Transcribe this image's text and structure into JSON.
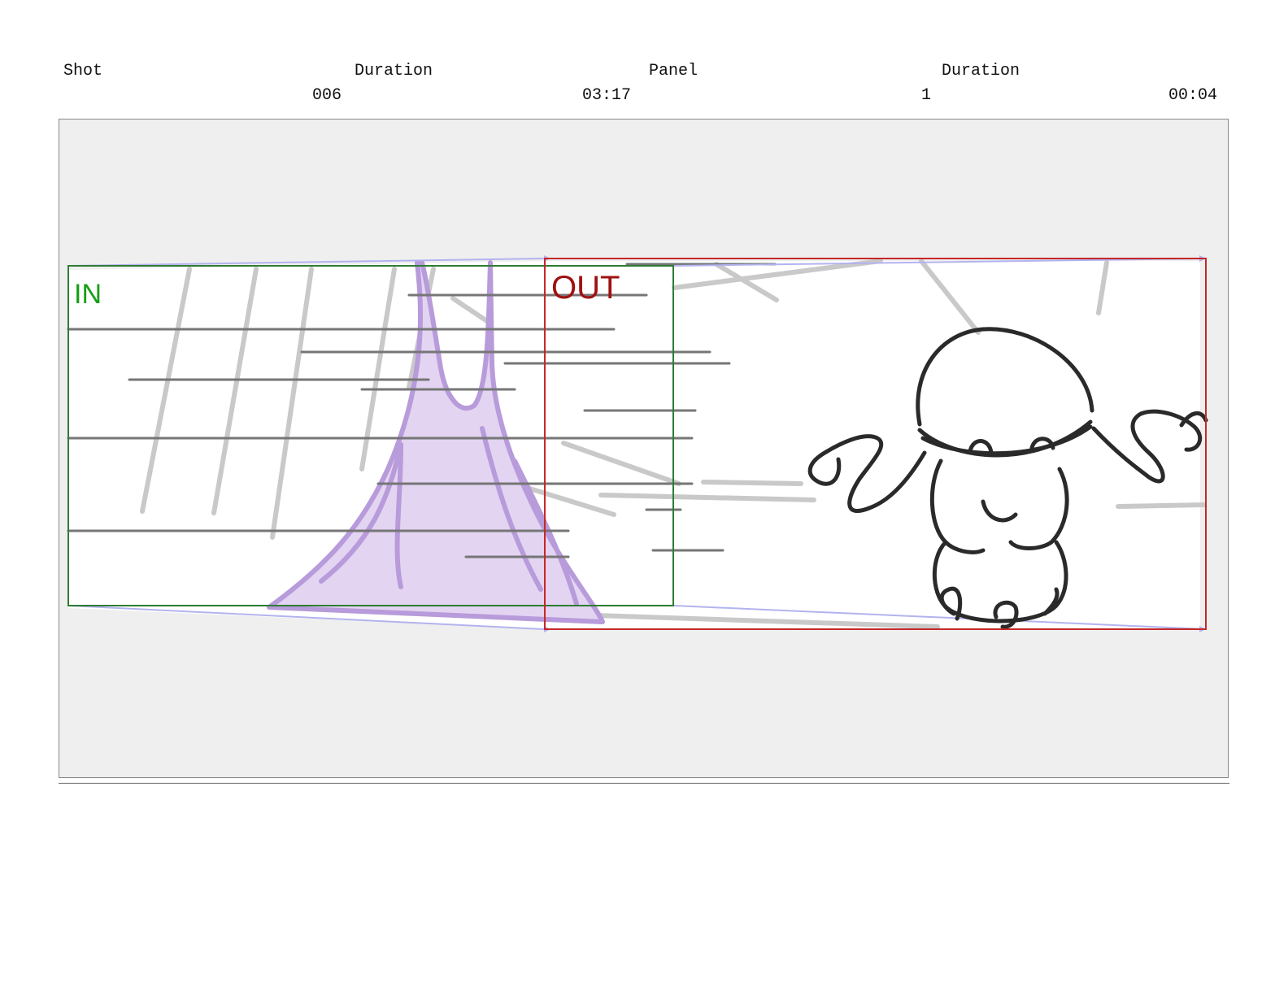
{
  "header": {
    "shot_label": "Shot",
    "shot_duration_label": "Duration",
    "panel_label": "Panel",
    "panel_duration_label": "Duration",
    "shot_value": "006",
    "shot_duration_value": "03:17",
    "panel_value": "1",
    "panel_duration_value": "00:04"
  },
  "panel": {
    "in_label": "IN",
    "out_label": "OUT",
    "colors": {
      "in_frame": "#2e7d32",
      "out_frame": "#c62828",
      "motion_guides": "#b3b3f0",
      "purple_fill": "#e3d4f2",
      "purple_stroke": "#b79ad9",
      "sketch_gray": "#c8c8c8",
      "speed_lines": "#777777",
      "character_ink": "#2a2a2a"
    }
  }
}
